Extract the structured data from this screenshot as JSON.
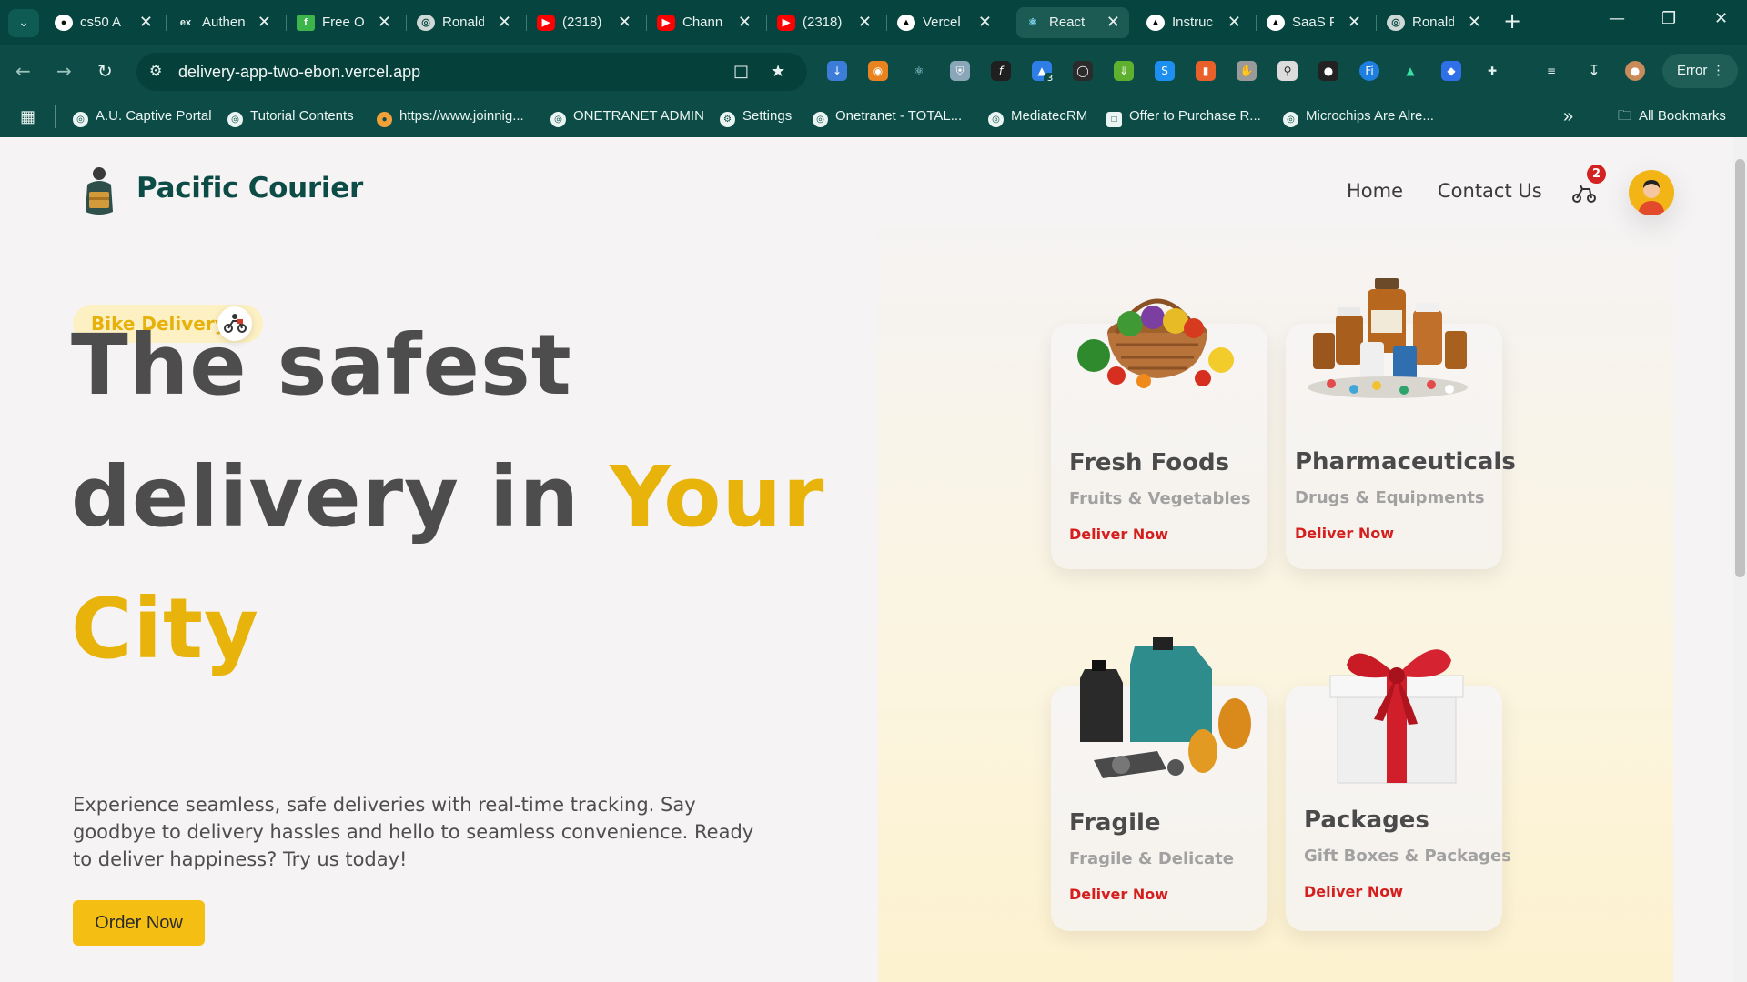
{
  "browser": {
    "tabs": [
      {
        "label": "cs50 A",
        "favicon": "github-icon",
        "active": false
      },
      {
        "label": "Authen",
        "favicon": "edx-icon",
        "active": false
      },
      {
        "label": "Free O",
        "favicon": "freecodecamp-icon",
        "active": false
      },
      {
        "label": "Ronald",
        "favicon": "globe-icon",
        "active": false
      },
      {
        "label": "(2318)",
        "favicon": "youtube-icon",
        "active": false
      },
      {
        "label": "Chann",
        "favicon": "youtube-icon",
        "active": false
      },
      {
        "label": "(2318)",
        "favicon": "youtube-icon",
        "active": false
      },
      {
        "label": "Vercel",
        "favicon": "vercel-icon",
        "active": false
      },
      {
        "label": "React",
        "favicon": "react-icon",
        "active": true
      },
      {
        "label": "Instruc",
        "favicon": "vercel-icon",
        "active": false
      },
      {
        "label": "SaaS F",
        "favicon": "vercel-icon",
        "active": false
      },
      {
        "label": "Ronald",
        "favicon": "globe-icon",
        "active": false
      }
    ],
    "url": "delivery-app-two-ebon.vercel.app",
    "profile_status": "Error",
    "extension_badge": "3",
    "bookmarks": [
      "A.U. Captive Portal",
      "Tutorial Contents",
      "https://www.joinnig...",
      "ONETRANET ADMIN",
      "Settings",
      "Onetranet - TOTAL...",
      "MediatecRM",
      "Offer to Purchase R...",
      "Microchips Are Alre..."
    ],
    "all_bookmarks_label": "All Bookmarks"
  },
  "site": {
    "brand": "Pacific Courier",
    "nav": {
      "home": "Home",
      "contact": "Contact Us"
    },
    "cart_count": "2",
    "colors": {
      "brand": "#0d4c46",
      "accent": "#e8b40c",
      "button": "#f4be13",
      "link": "#d51f1f"
    }
  },
  "hero": {
    "pill_label": "Bike Delivery",
    "headline_line1": "The safest",
    "headline_line2": "delivery in",
    "headline_accent1": "Your",
    "headline_accent2": "City",
    "description": "Experience seamless, safe deliveries with real-time tracking. Say goodbye to delivery hassles and hello to seamless convenience. Ready to deliver happiness? Try us today!",
    "cta": "Order Now"
  },
  "cards": [
    {
      "title": "Fresh Foods",
      "subtitle": "Fruits & Vegetables",
      "link": "Deliver Now",
      "image": "fruit-basket-image"
    },
    {
      "title": "Pharmaceuticals",
      "subtitle": "Drugs & Equipments",
      "link": "Deliver Now",
      "image": "medicine-bottles-image"
    },
    {
      "title": "Fragile",
      "subtitle": "Fragile & Delicate",
      "link": "Deliver Now",
      "image": "car-parts-image"
    },
    {
      "title": "Packages",
      "subtitle": "Gift Boxes & Packages",
      "link": "Deliver Now",
      "image": "gift-box-image"
    }
  ]
}
